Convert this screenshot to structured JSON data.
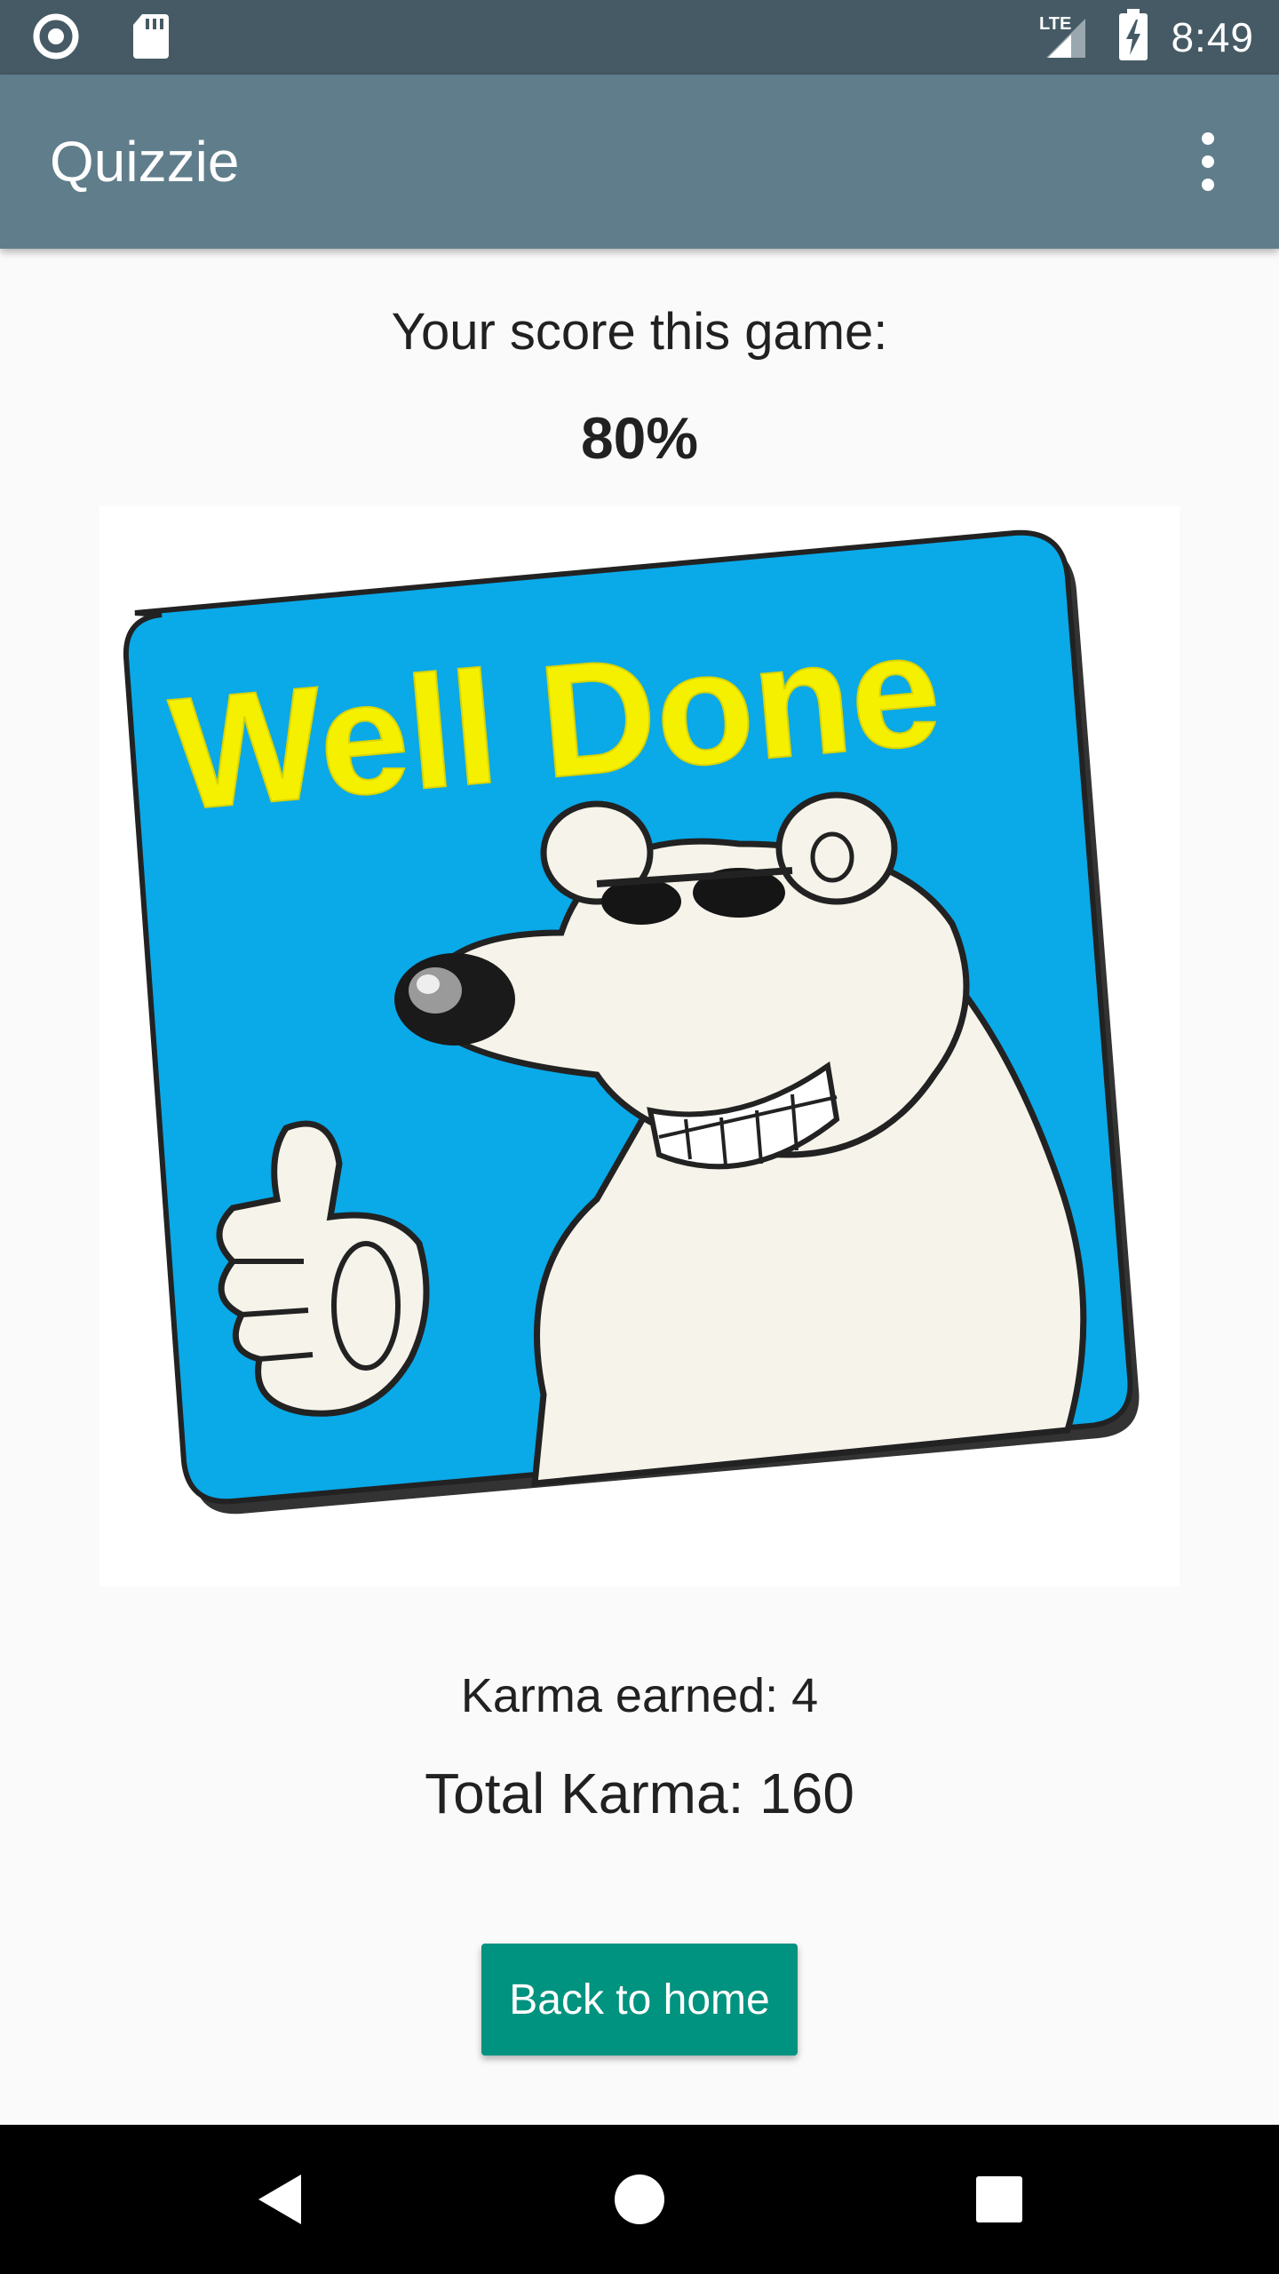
{
  "status_bar": {
    "time": "8:49",
    "network_label": "LTE",
    "left_icons": [
      "notification-circle-icon",
      "sd-card-icon"
    ],
    "right_icons": [
      "signal-icon",
      "battery-charging-icon"
    ]
  },
  "app_bar": {
    "title": "Quizzie",
    "menu_icon": "overflow-menu-icon"
  },
  "result": {
    "score_label": "Your score this game:",
    "score_value": "80%",
    "image_text": "Well Done",
    "karma_earned": "Karma earned: 4",
    "total_karma": "Total Karma: 160"
  },
  "actions": {
    "back_home_label": "Back to home"
  },
  "nav_bar": {
    "buttons": [
      "back-icon",
      "home-icon",
      "recents-icon"
    ]
  },
  "colors": {
    "status_bar": "#455a64",
    "app_bar": "#607d8b",
    "accent_button": "#00937f",
    "image_blue": "#0aa9e8",
    "image_yellow": "#f5f000"
  }
}
